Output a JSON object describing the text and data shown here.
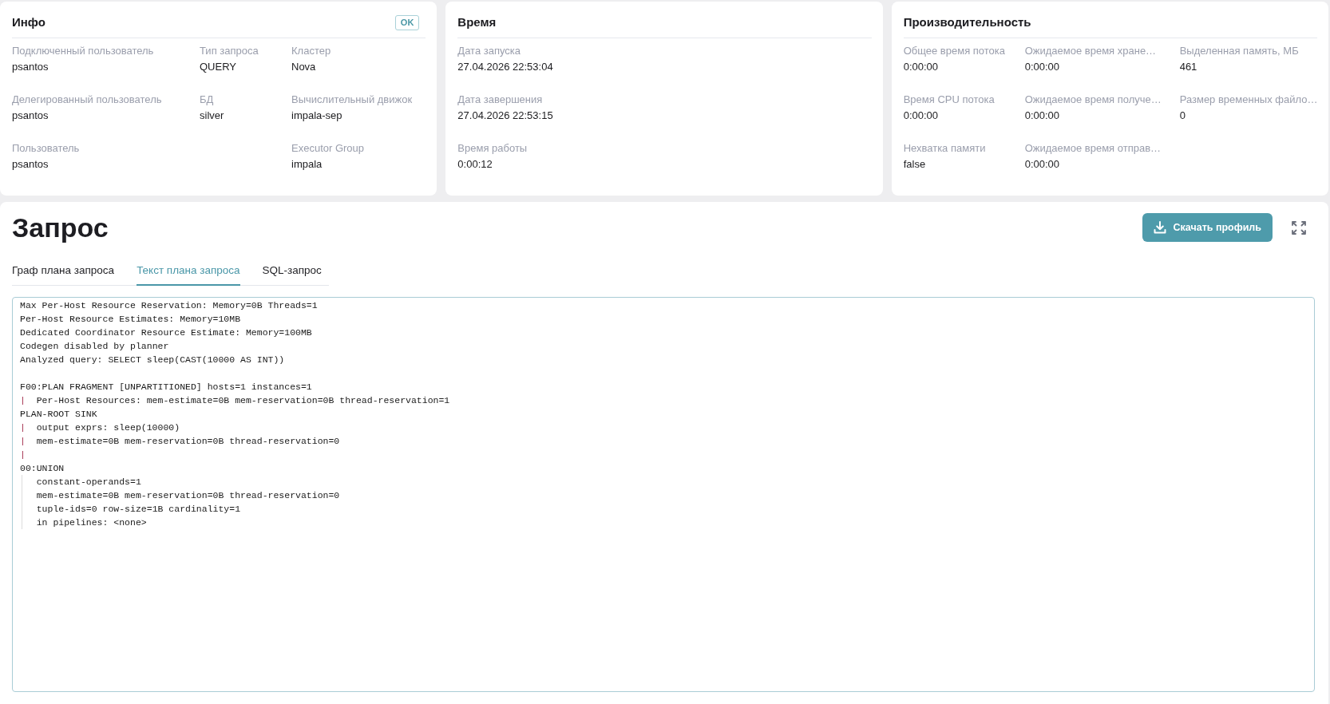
{
  "cards": [
    {
      "title": "Инфо",
      "status": "OK",
      "columns": [
        {
          "fields": [
            {
              "label": "Подключенный пользователь",
              "value": "psantos"
            },
            {
              "label": "Делегированный пользователь",
              "value": "psantos"
            },
            {
              "label": "Пользователь",
              "value": "psantos"
            }
          ]
        },
        {
          "fields": [
            {
              "label": "Тип запроса",
              "value": "QUERY"
            },
            {
              "label": "БД",
              "value": "silver"
            }
          ]
        },
        {
          "fields": [
            {
              "label": "Кластер",
              "value": "Nova"
            },
            {
              "label": "Вычислительный движок",
              "value": "impala-sep"
            },
            {
              "label": "Executor Group",
              "value": "impala"
            }
          ]
        }
      ]
    },
    {
      "title": "Время",
      "columns": [
        {
          "fields": [
            {
              "label": "Дата запуска",
              "value": "27.04.2026 22:53:04"
            },
            {
              "label": "Дата завершения",
              "value": "27.04.2026 22:53:15"
            },
            {
              "label": "Время работы",
              "value": "0:00:12"
            }
          ]
        }
      ]
    },
    {
      "title": "Производительность",
      "columns": [
        {
          "fields": [
            {
              "label": "Общее время потока",
              "value": "0:00:00"
            },
            {
              "label": "Время CPU потока",
              "value": "0:00:00"
            },
            {
              "label": "Нехватка памяти",
              "value": "false"
            }
          ]
        },
        {
          "fields": [
            {
              "label": "Ожидаемое время хране…",
              "value": "0:00:00"
            },
            {
              "label": "Ожидаемое время получе…",
              "value": "0:00:00"
            },
            {
              "label": "Ожидаемое время отправ…",
              "value": "0:00:00"
            }
          ]
        },
        {
          "fields": [
            {
              "label": "Выделенная память, МБ",
              "value": "461"
            },
            {
              "label": "Размер временных файло…",
              "value": "0"
            }
          ]
        }
      ]
    }
  ],
  "query": {
    "title": "Запрос",
    "download_button": "Скачать профиль",
    "tabs": [
      {
        "label": "Граф плана запроса",
        "selected": false
      },
      {
        "label": "Текст плана запроса",
        "selected": true
      },
      {
        "label": "SQL-запрос",
        "selected": false
      }
    ],
    "plan_text": {
      "lines": [
        {
          "kind": "line",
          "text": "Max Per-Host Resource Reservation: Memory=0B Threads=1"
        },
        {
          "kind": "line",
          "text": "Per-Host Resource Estimates: Memory=10MB"
        },
        {
          "kind": "line",
          "text": "Dedicated Coordinator Resource Estimate: Memory=100MB"
        },
        {
          "kind": "line",
          "text": "Codegen disabled by planner"
        },
        {
          "kind": "line",
          "text": "Analyzed query: SELECT sleep(CAST(10000 AS INT))"
        },
        {
          "kind": "blank"
        },
        {
          "kind": "line",
          "text": "F00:PLAN FRAGMENT [UNPARTITIONED] hosts=1 instances=1"
        },
        {
          "kind": "piped",
          "pipe": "|",
          "text": "Per-Host Resources: mem-estimate=0B mem-reservation=0B thread-reservation=1"
        },
        {
          "kind": "line",
          "text": "PLAN-ROOT SINK"
        },
        {
          "kind": "piped",
          "pipe": "|",
          "text": "output exprs: sleep(10000)"
        },
        {
          "kind": "piped",
          "pipe": "|",
          "text": "mem-estimate=0B mem-reservation=0B thread-reservation=0"
        },
        {
          "kind": "piped",
          "pipe": "|"
        },
        {
          "kind": "line",
          "text": "00:UNION",
          "children": [
            {
              "kind": "line",
              "text": "constant-operands=1"
            },
            {
              "kind": "line",
              "text": "mem-estimate=0B mem-reservation=0B thread-reservation=0"
            },
            {
              "kind": "line",
              "text": "tuple-ids=0 row-size=1B cardinality=1"
            },
            {
              "kind": "line",
              "text": "in pipelines: <none>"
            }
          ]
        }
      ]
    }
  }
}
